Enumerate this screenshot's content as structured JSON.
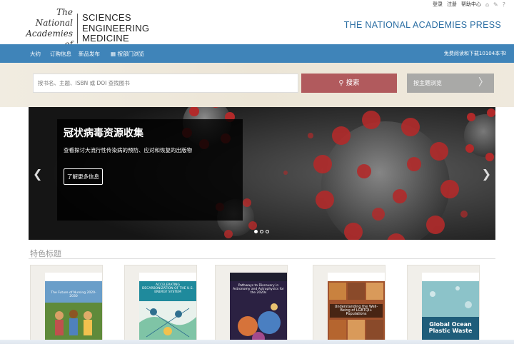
{
  "header": {
    "logo_left_line1": "The National",
    "logo_left_line2": "Academies of",
    "logo_right_line1": "SCIENCES",
    "logo_right_line2": "ENGINEERING",
    "logo_right_line3": "MEDICINE",
    "press": "THE NATIONAL ACADEMIES PRESS",
    "util": {
      "login": "登录",
      "register": "注册",
      "help_center": "帮助中心"
    }
  },
  "nav": {
    "items": [
      "大约",
      "订购信息",
      "新品发布",
      "按部门浏览"
    ],
    "right_text": "免费阅读和下载10104本书!"
  },
  "search": {
    "placeholder": "按书名、主题、ISBN 或 DOI 查找图书",
    "button": "搜索",
    "browse": "按主题浏览"
  },
  "hero": {
    "title": "冠状病毒资源收集",
    "subtitle": "查看探讨大流行性传染病的预防、应对和恢复的出版物",
    "cta": "了解更多信息",
    "slides": 3,
    "active_slide": 1
  },
  "featured": {
    "title": "特色标题",
    "books": [
      {
        "caption": "The Future of Nursing 2020-2030",
        "color": "#3a6b3f"
      },
      {
        "caption": "ACCELERATING DECARBONIZATION OF THE U.S. ENERGY SYSTEM",
        "color": "#1f8a9c"
      },
      {
        "caption": "Pathways to Discovery in Astronomy and Astrophysics for the 2020s",
        "color": "#3a2a55"
      },
      {
        "caption": "Understanding the Well-Being of LGBTQI+ Populations",
        "color": "#a0522d"
      },
      {
        "caption": "Global Ocean Plastic Waste",
        "color": "#2a6f8f"
      }
    ]
  },
  "colors": {
    "nav": "#3f84b9",
    "search_button": "#b15a5d",
    "press": "#2b6ea3"
  }
}
